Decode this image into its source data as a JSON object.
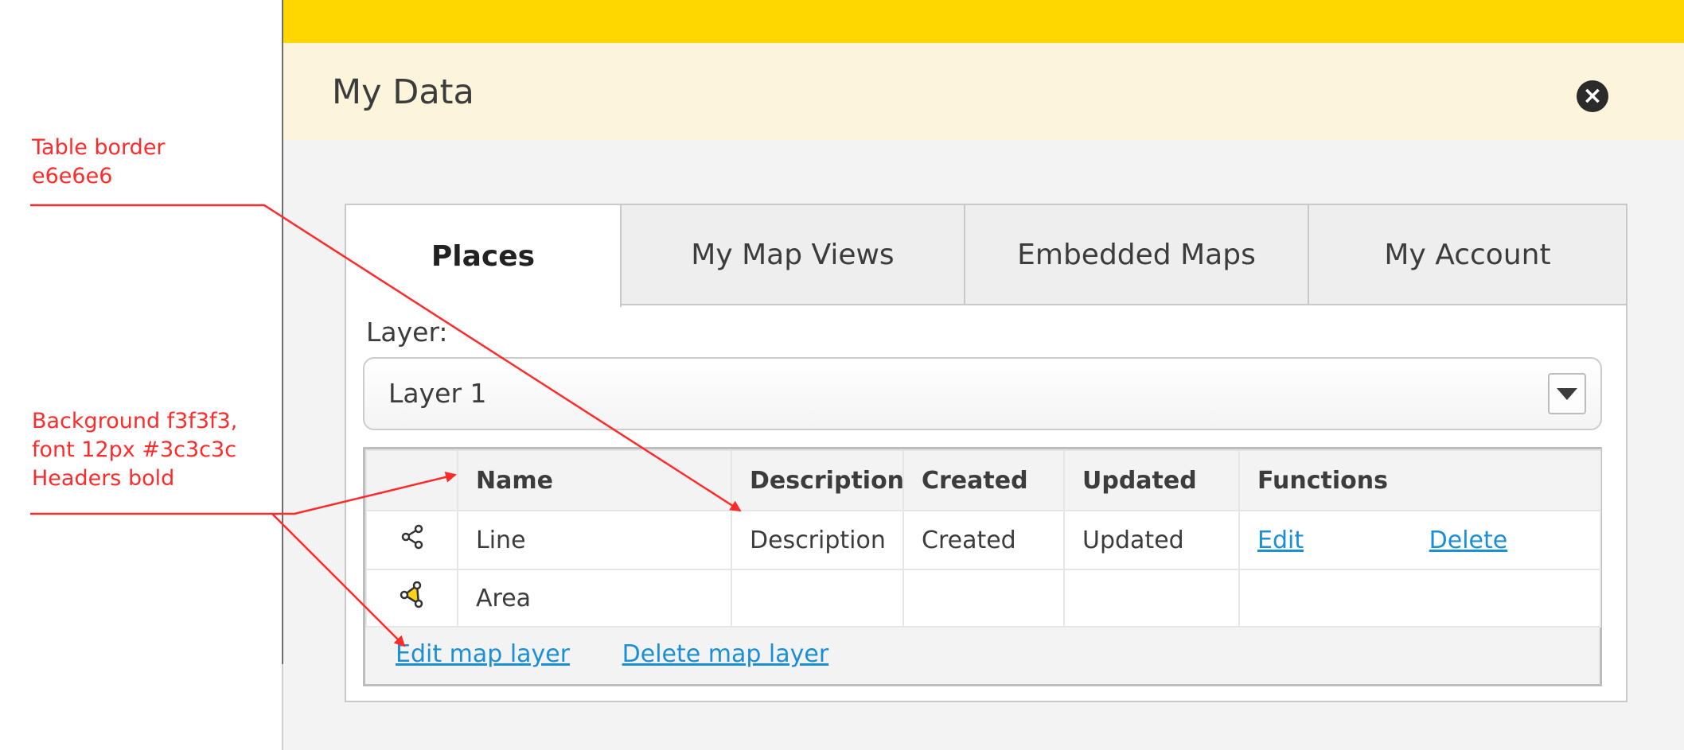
{
  "annotations": {
    "table_border": [
      "Table border",
      "e6e6e6"
    ],
    "background": [
      "Background f3f3f3,",
      "font 12px #3c3c3c",
      "Headers bold"
    ]
  },
  "dialog": {
    "title": "My Data",
    "close_icon": "close-icon",
    "colors": {
      "top_bar": "#ffd700",
      "header": "#fcf5dc",
      "body": "#f3f3f3",
      "annotation": "#ff2a2a",
      "link": "#1a8fd6"
    }
  },
  "tabs": [
    {
      "label": "Places",
      "active": true
    },
    {
      "label": "My Map Views",
      "active": false
    },
    {
      "label": "Embedded Maps",
      "active": false
    },
    {
      "label": "My Account",
      "active": false
    }
  ],
  "layer": {
    "label": "Layer:",
    "selected": "Layer 1"
  },
  "table": {
    "headers": [
      "Name",
      "Description",
      "Created",
      "Updated",
      "Functions"
    ],
    "rows": [
      {
        "icon": "line-icon",
        "name": "Line",
        "description": "Description",
        "created": "Created",
        "updated": "Updated",
        "edit": "Edit",
        "delete": "Delete"
      },
      {
        "icon": "area-icon",
        "name": "Area",
        "description": "",
        "created": "",
        "updated": "",
        "edit": "",
        "delete": ""
      }
    ],
    "footer": {
      "edit_layer": "Edit map layer",
      "delete_layer": "Delete map layer"
    }
  }
}
